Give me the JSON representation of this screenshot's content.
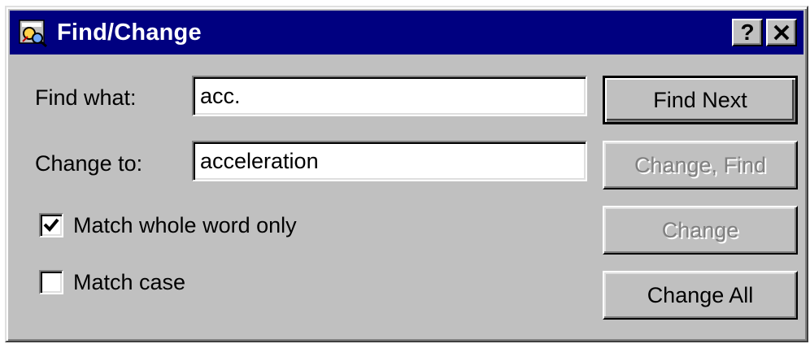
{
  "window": {
    "title": "Find/Change",
    "help_label": "?",
    "close_label": "✕",
    "app_icon": "find-change-app-icon"
  },
  "form": {
    "find_label": "Find what:",
    "find_value": "acc.",
    "change_label": "Change to:",
    "change_value": "acceleration"
  },
  "options": {
    "whole_word_label": "Match whole word only",
    "whole_word_checked": true,
    "match_case_label": "Match case",
    "match_case_checked": false
  },
  "buttons": {
    "find_next": "Find Next",
    "change_find": "Change, Find",
    "change": "Change",
    "change_all": "Change All"
  },
  "colors": {
    "titlebar": "#000080",
    "face": "#c0c0c0",
    "disabled_text": "#808080"
  }
}
